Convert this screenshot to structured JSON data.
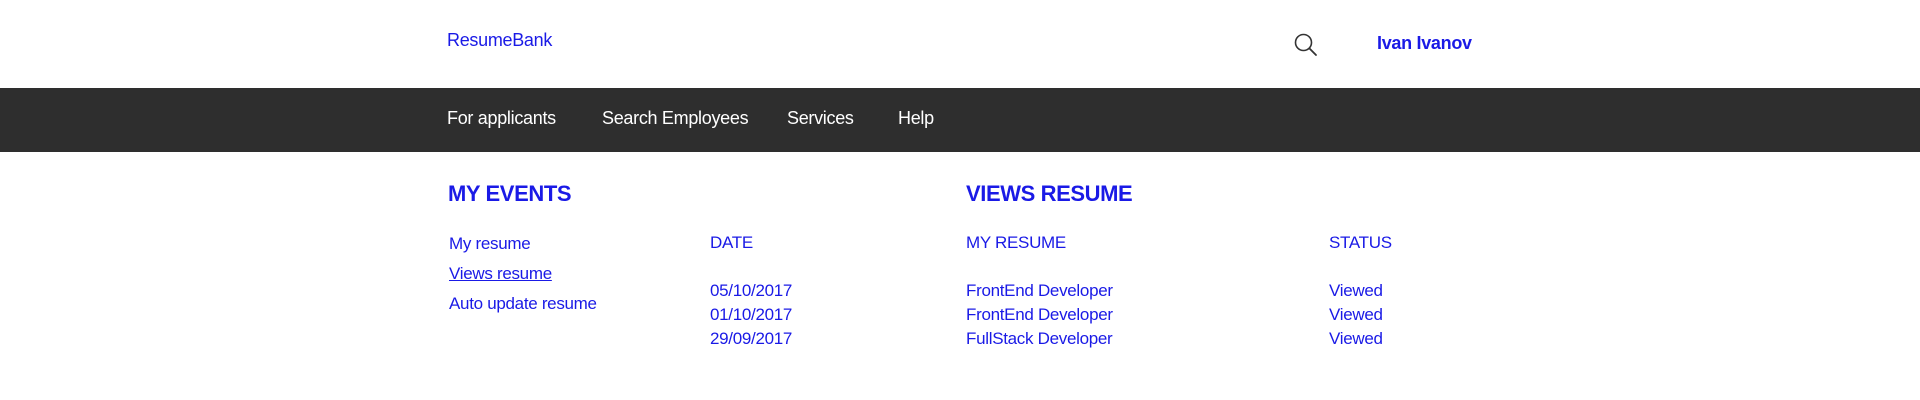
{
  "header": {
    "logo": "ResumeBank",
    "user_name": "Ivan Ivanov",
    "search_icon": "search-icon"
  },
  "nav": {
    "items": [
      {
        "label": "For applicants"
      },
      {
        "label": "Search Employees"
      },
      {
        "label": "Services"
      },
      {
        "label": "Help"
      }
    ]
  },
  "events": {
    "title": "MY EVENTS",
    "links": [
      {
        "label": "My resume"
      },
      {
        "label": "Views resume"
      },
      {
        "label": "Auto update resume"
      }
    ],
    "active_link": "Views resume"
  },
  "views": {
    "title": "VIEWS RESUME",
    "columns": {
      "date": "DATE",
      "resume": "MY RESUME",
      "status": "STATUS"
    },
    "rows": [
      {
        "date": "05/10/2017",
        "resume": "FrontEnd Developer",
        "status": "Viewed"
      },
      {
        "date": "01/10/2017",
        "resume": "FrontEnd Developer",
        "status": "Viewed"
      },
      {
        "date": "29/09/2017",
        "resume": "FullStack Developer",
        "status": "Viewed"
      }
    ]
  },
  "colors": {
    "accent": "#1a1ae6",
    "navbar": "#2e2e2e"
  }
}
